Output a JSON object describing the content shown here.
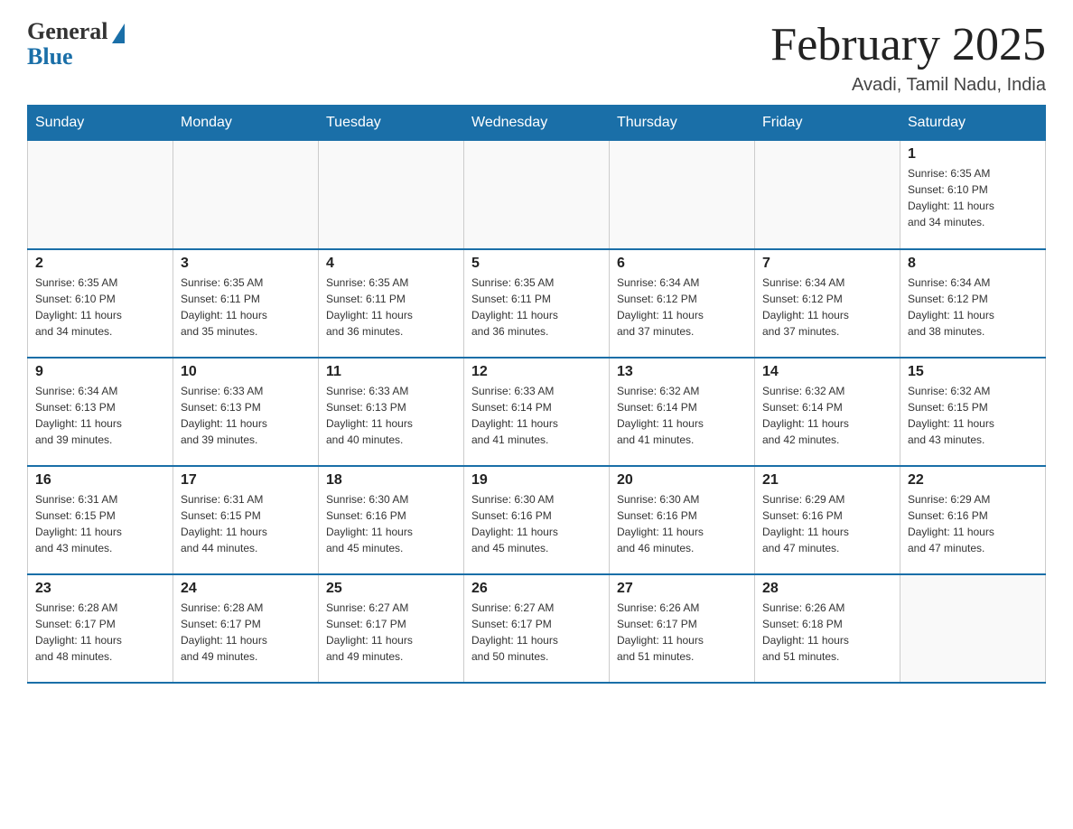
{
  "header": {
    "logo_general": "General",
    "logo_blue": "Blue",
    "month_title": "February 2025",
    "location": "Avadi, Tamil Nadu, India"
  },
  "days_of_week": [
    "Sunday",
    "Monday",
    "Tuesday",
    "Wednesday",
    "Thursday",
    "Friday",
    "Saturday"
  ],
  "weeks": [
    [
      {
        "date": "",
        "info": ""
      },
      {
        "date": "",
        "info": ""
      },
      {
        "date": "",
        "info": ""
      },
      {
        "date": "",
        "info": ""
      },
      {
        "date": "",
        "info": ""
      },
      {
        "date": "",
        "info": ""
      },
      {
        "date": "1",
        "info": "Sunrise: 6:35 AM\nSunset: 6:10 PM\nDaylight: 11 hours\nand 34 minutes."
      }
    ],
    [
      {
        "date": "2",
        "info": "Sunrise: 6:35 AM\nSunset: 6:10 PM\nDaylight: 11 hours\nand 34 minutes."
      },
      {
        "date": "3",
        "info": "Sunrise: 6:35 AM\nSunset: 6:11 PM\nDaylight: 11 hours\nand 35 minutes."
      },
      {
        "date": "4",
        "info": "Sunrise: 6:35 AM\nSunset: 6:11 PM\nDaylight: 11 hours\nand 36 minutes."
      },
      {
        "date": "5",
        "info": "Sunrise: 6:35 AM\nSunset: 6:11 PM\nDaylight: 11 hours\nand 36 minutes."
      },
      {
        "date": "6",
        "info": "Sunrise: 6:34 AM\nSunset: 6:12 PM\nDaylight: 11 hours\nand 37 minutes."
      },
      {
        "date": "7",
        "info": "Sunrise: 6:34 AM\nSunset: 6:12 PM\nDaylight: 11 hours\nand 37 minutes."
      },
      {
        "date": "8",
        "info": "Sunrise: 6:34 AM\nSunset: 6:12 PM\nDaylight: 11 hours\nand 38 minutes."
      }
    ],
    [
      {
        "date": "9",
        "info": "Sunrise: 6:34 AM\nSunset: 6:13 PM\nDaylight: 11 hours\nand 39 minutes."
      },
      {
        "date": "10",
        "info": "Sunrise: 6:33 AM\nSunset: 6:13 PM\nDaylight: 11 hours\nand 39 minutes."
      },
      {
        "date": "11",
        "info": "Sunrise: 6:33 AM\nSunset: 6:13 PM\nDaylight: 11 hours\nand 40 minutes."
      },
      {
        "date": "12",
        "info": "Sunrise: 6:33 AM\nSunset: 6:14 PM\nDaylight: 11 hours\nand 41 minutes."
      },
      {
        "date": "13",
        "info": "Sunrise: 6:32 AM\nSunset: 6:14 PM\nDaylight: 11 hours\nand 41 minutes."
      },
      {
        "date": "14",
        "info": "Sunrise: 6:32 AM\nSunset: 6:14 PM\nDaylight: 11 hours\nand 42 minutes."
      },
      {
        "date": "15",
        "info": "Sunrise: 6:32 AM\nSunset: 6:15 PM\nDaylight: 11 hours\nand 43 minutes."
      }
    ],
    [
      {
        "date": "16",
        "info": "Sunrise: 6:31 AM\nSunset: 6:15 PM\nDaylight: 11 hours\nand 43 minutes."
      },
      {
        "date": "17",
        "info": "Sunrise: 6:31 AM\nSunset: 6:15 PM\nDaylight: 11 hours\nand 44 minutes."
      },
      {
        "date": "18",
        "info": "Sunrise: 6:30 AM\nSunset: 6:16 PM\nDaylight: 11 hours\nand 45 minutes."
      },
      {
        "date": "19",
        "info": "Sunrise: 6:30 AM\nSunset: 6:16 PM\nDaylight: 11 hours\nand 45 minutes."
      },
      {
        "date": "20",
        "info": "Sunrise: 6:30 AM\nSunset: 6:16 PM\nDaylight: 11 hours\nand 46 minutes."
      },
      {
        "date": "21",
        "info": "Sunrise: 6:29 AM\nSunset: 6:16 PM\nDaylight: 11 hours\nand 47 minutes."
      },
      {
        "date": "22",
        "info": "Sunrise: 6:29 AM\nSunset: 6:16 PM\nDaylight: 11 hours\nand 47 minutes."
      }
    ],
    [
      {
        "date": "23",
        "info": "Sunrise: 6:28 AM\nSunset: 6:17 PM\nDaylight: 11 hours\nand 48 minutes."
      },
      {
        "date": "24",
        "info": "Sunrise: 6:28 AM\nSunset: 6:17 PM\nDaylight: 11 hours\nand 49 minutes."
      },
      {
        "date": "25",
        "info": "Sunrise: 6:27 AM\nSunset: 6:17 PM\nDaylight: 11 hours\nand 49 minutes."
      },
      {
        "date": "26",
        "info": "Sunrise: 6:27 AM\nSunset: 6:17 PM\nDaylight: 11 hours\nand 50 minutes."
      },
      {
        "date": "27",
        "info": "Sunrise: 6:26 AM\nSunset: 6:17 PM\nDaylight: 11 hours\nand 51 minutes."
      },
      {
        "date": "28",
        "info": "Sunrise: 6:26 AM\nSunset: 6:18 PM\nDaylight: 11 hours\nand 51 minutes."
      },
      {
        "date": "",
        "info": ""
      }
    ]
  ]
}
